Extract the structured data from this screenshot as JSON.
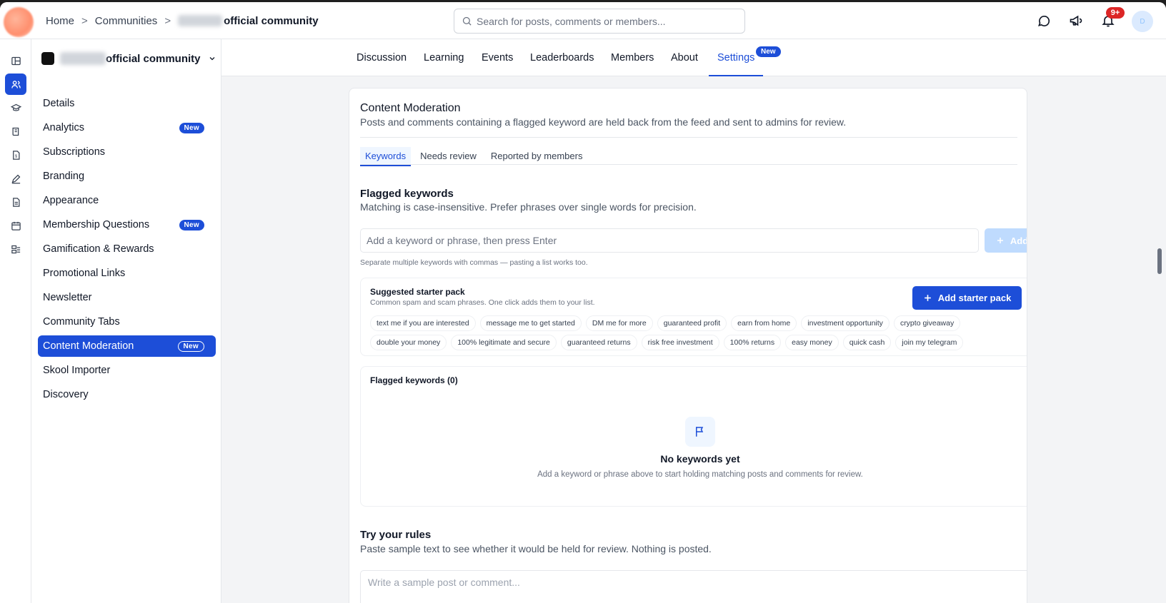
{
  "breadcrumb": {
    "home": "Home",
    "communities": "Communities",
    "current": "official community",
    "separator": ">"
  },
  "search": {
    "placeholder": "Search for posts, comments or members..."
  },
  "notifications": {
    "badge": "9+"
  },
  "avatar": {
    "alt": "D"
  },
  "community": {
    "name": "official community"
  },
  "sidebar": {
    "items": [
      {
        "label": "Details"
      },
      {
        "label": "Analytics",
        "badge": "New"
      },
      {
        "label": "Subscriptions"
      },
      {
        "label": "Branding"
      },
      {
        "label": "Appearance"
      },
      {
        "label": "Membership Questions",
        "badge": "New"
      },
      {
        "label": "Gamification & Rewards"
      },
      {
        "label": "Promotional Links"
      },
      {
        "label": "Newsletter"
      },
      {
        "label": "Community Tabs"
      },
      {
        "label": "Content Moderation",
        "badge": "New",
        "active": true
      },
      {
        "label": "Skool Importer"
      },
      {
        "label": "Discovery"
      }
    ]
  },
  "tabs": [
    {
      "label": "Discussion"
    },
    {
      "label": "Learning"
    },
    {
      "label": "Events"
    },
    {
      "label": "Leaderboards"
    },
    {
      "label": "Members"
    },
    {
      "label": "About"
    },
    {
      "label": "Settings",
      "badge": "New",
      "active": true
    }
  ],
  "moderation": {
    "title": "Content Moderation",
    "description": "Posts and comments containing a flagged keyword are held back from the feed and sent to admins for review.",
    "subtabs": [
      {
        "label": "Keywords"
      },
      {
        "label": "Needs review"
      },
      {
        "label": "Reported by members"
      }
    ],
    "keywords_title": "Flagged keywords",
    "keywords_desc": "Matching is case-insensitive. Prefer phrases over single words for precision.",
    "input_placeholder": "Add a keyword or phrase, then press Enter",
    "add_label": "Add",
    "hint": "Separate multiple keywords with commas — pasting a list works too.",
    "starter": {
      "title": "Suggested starter pack",
      "desc": "Common spam and scam phrases. One click adds them to your list.",
      "button": "Add starter pack",
      "chips": [
        "text me if you are interested",
        "message me to get started",
        "DM me for more",
        "guaranteed profit",
        "earn from home",
        "investment opportunity",
        "crypto giveaway",
        "double your money",
        "100% legitimate and secure",
        "guaranteed returns",
        "risk free investment",
        "100% returns",
        "easy money",
        "quick cash",
        "join my telegram"
      ]
    },
    "list": {
      "title": "Flagged keywords (0)",
      "empty_title": "No keywords yet",
      "empty_desc": "Add a keyword or phrase above to start holding matching posts and comments for review."
    },
    "try": {
      "title": "Try your rules",
      "desc": "Paste sample text to see whether it would be held for review. Nothing is posted.",
      "placeholder": "Write a sample post or comment..."
    }
  }
}
